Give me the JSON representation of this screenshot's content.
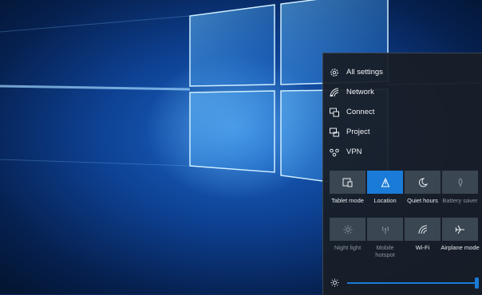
{
  "action_center": {
    "quick_links": [
      {
        "label": "All settings",
        "icon": "gear-icon"
      },
      {
        "label": "Network",
        "icon": "network-icon"
      },
      {
        "label": "Connect",
        "icon": "connect-icon"
      },
      {
        "label": "Project",
        "icon": "project-icon"
      },
      {
        "label": "VPN",
        "icon": "vpn-icon"
      }
    ],
    "quick_actions": [
      {
        "label": "Tablet mode",
        "icon": "tablet-mode-icon",
        "state": "off"
      },
      {
        "label": "Location",
        "icon": "location-icon",
        "state": "on"
      },
      {
        "label": "Quiet hours",
        "icon": "moon-icon",
        "state": "off"
      },
      {
        "label": "Battery saver",
        "icon": "battery-saver-icon",
        "state": "unavailable"
      },
      {
        "label": "Night light",
        "icon": "sun-icon",
        "state": "unavailable"
      },
      {
        "label": "Mobile\nhotspot",
        "icon": "hotspot-icon",
        "state": "unavailable"
      },
      {
        "label": "Wi-Fi",
        "icon": "wifi-icon",
        "state": "off"
      },
      {
        "label": "Airplane mode",
        "icon": "airplane-icon",
        "state": "off"
      }
    ],
    "brightness": {
      "icon": "brightness-icon",
      "level": 1.0
    },
    "colors": {
      "accent": "#1a7bd8",
      "panel": "#181e26",
      "tile": "#3a4652"
    }
  }
}
